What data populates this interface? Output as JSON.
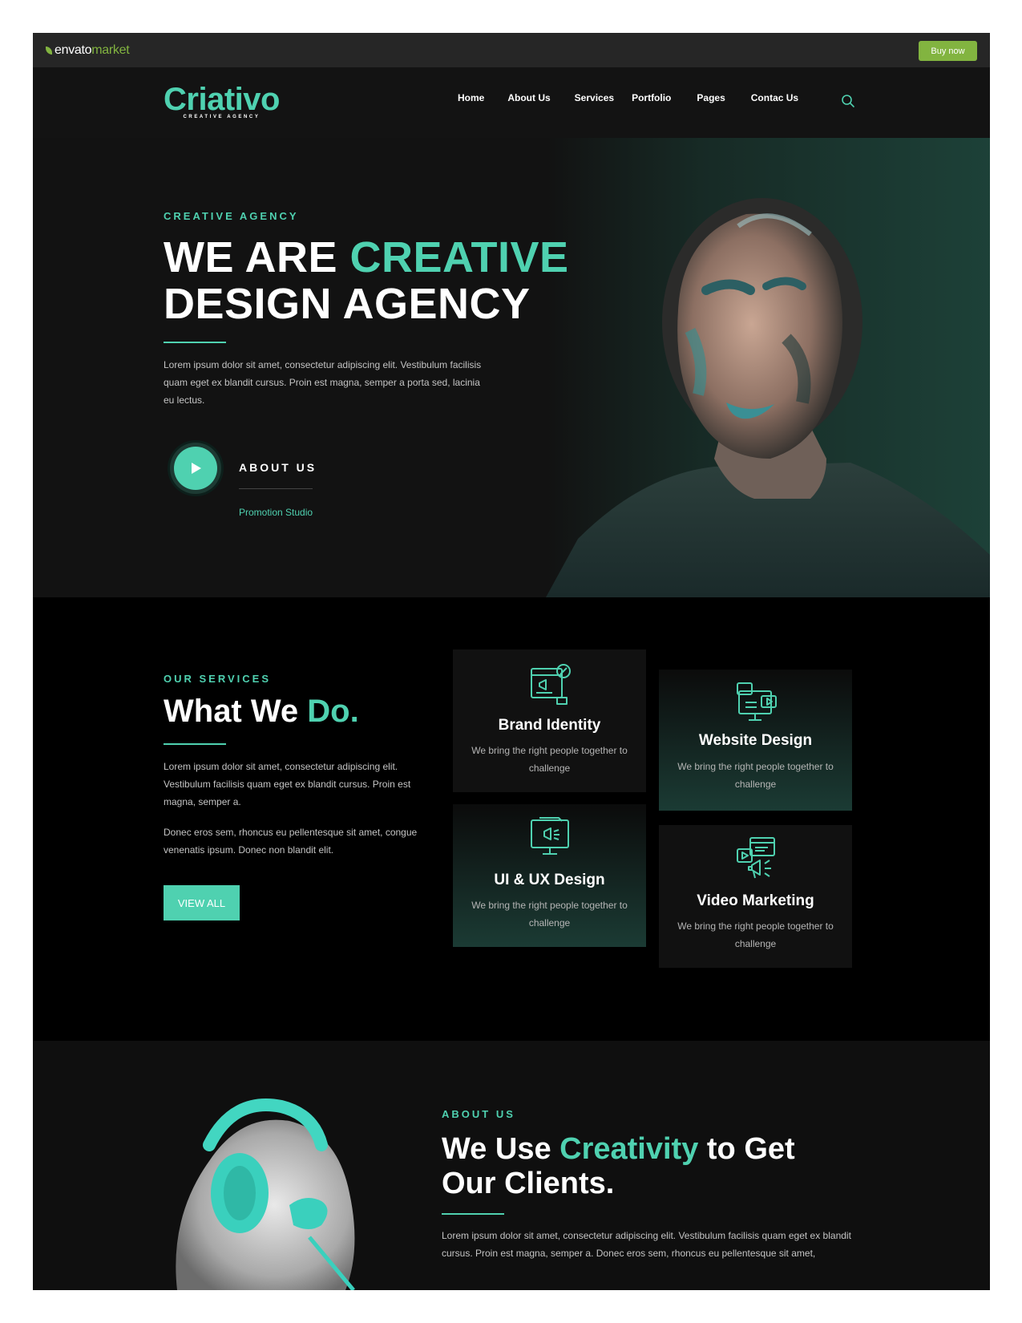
{
  "envato_bar": {
    "logo_main": "envato",
    "logo_market": "market",
    "buy_now": "Buy now"
  },
  "brand": {
    "name": "Criativo",
    "tagline": "CREATIVE AGENCY"
  },
  "nav": {
    "items": [
      "Home",
      "About Us",
      "Services",
      "Portfolio",
      "Pages",
      "Contac Us"
    ],
    "search_icon": "search-icon"
  },
  "hero": {
    "eyebrow": "CREATIVE AGENCY",
    "title_part1": "WE ARE ",
    "title_highlight": "CREATIVE",
    "title_line2": "DESIGN AGENCY",
    "text": "Lorem ipsum dolor sit amet, consectetur adipiscing elit. Vestibulum facilisis quam eget ex blandit cursus. Proin est magna, semper a porta sed, lacinia eu lectus.",
    "about_label": "ABOUT US",
    "promo": "Promotion Studio"
  },
  "services": {
    "eyebrow": "OUR SERVICES",
    "title_part1": "What We ",
    "title_highlight": "Do.",
    "p1": "Lorem ipsum dolor sit amet, consectetur adipiscing elit. Vestibulum facilisis quam eget ex blandit cursus. Proin est magna, semper a.",
    "p2": "Donec eros sem, rhoncus eu pellentesque sit amet, congue venenatis ipsum. Donec non blandit elit.",
    "view_all": "VIEW ALL",
    "cards": [
      {
        "title": "Brand Identity",
        "desc": "We bring the right people together to challenge",
        "icon": "brand-identity-icon"
      },
      {
        "title": "Website Design",
        "desc": "We bring the right people together to challenge",
        "icon": "website-design-icon"
      },
      {
        "title": "UI & UX Design",
        "desc": "We bring the right people together to challenge",
        "icon": "ui-ux-icon"
      },
      {
        "title": "Video Marketing",
        "desc": "We bring the right people together to challenge",
        "icon": "video-marketing-icon"
      }
    ]
  },
  "about": {
    "eyebrow": "ABOUT US",
    "title_part1": "We Use ",
    "title_highlight": "Creativity",
    "title_part2": " to Get",
    "title_line2": "Our Clients.",
    "text": "Lorem ipsum dolor sit amet, consectetur adipiscing elit. Vestibulum facilisis quam eget ex blandit cursus. Proin est magna, semper a. Donec eros sem, rhoncus eu pellentesque sit amet,"
  },
  "colors": {
    "accent": "#4fd1b0",
    "envato_green": "#82b440",
    "background": "#000000"
  }
}
